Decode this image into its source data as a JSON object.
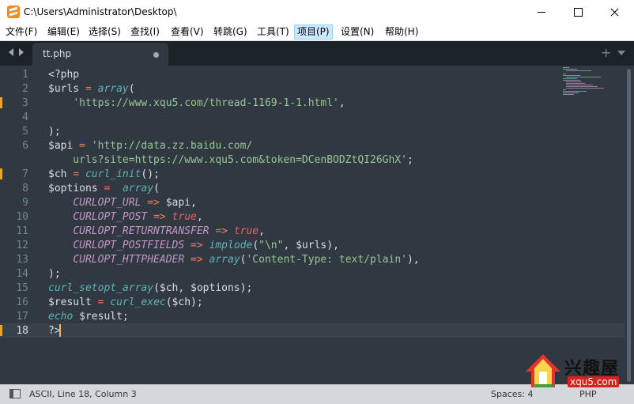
{
  "window": {
    "title": "C:\\Users\\Administrator\\Desktop\\"
  },
  "menu": [
    {
      "label": "文件(F)"
    },
    {
      "label": "编辑(E)"
    },
    {
      "label": "选择(S)"
    },
    {
      "label": "查找(I)"
    },
    {
      "label": "查看(V)"
    },
    {
      "label": "转跳(G)"
    },
    {
      "label": "工具(T)"
    },
    {
      "label": "项目(P)",
      "active": true
    },
    {
      "label": "设置(N)"
    },
    {
      "label": "帮助(H)"
    }
  ],
  "tabs": [
    {
      "label": "tt.php",
      "modified": true
    }
  ],
  "editor": {
    "line_numbers": [
      "1",
      "2",
      "3",
      "4",
      "5",
      "6",
      "",
      "7",
      "8",
      "9",
      "10",
      "11",
      "12",
      "13",
      "14",
      "15",
      "16",
      "17",
      "18"
    ],
    "current_line": "18",
    "lines": [
      [
        {
          "t": "<?php",
          "c": "plain"
        }
      ],
      [
        {
          "t": "$urls ",
          "c": "plain"
        },
        {
          "t": "=",
          "c": "op"
        },
        {
          "t": " ",
          "c": "plain"
        },
        {
          "t": "array",
          "c": "func"
        },
        {
          "t": "(",
          "c": "plain"
        }
      ],
      [
        {
          "t": "    ",
          "c": "plain"
        },
        {
          "t": "'https://www.xqu5.com/thread-1169-1-1.html'",
          "c": "str"
        },
        {
          "t": ",",
          "c": "plain"
        }
      ],
      [
        {
          "t": "",
          "c": "plain"
        }
      ],
      [
        {
          "t": ");",
          "c": "plain"
        }
      ],
      [
        {
          "t": "$api ",
          "c": "plain"
        },
        {
          "t": "=",
          "c": "op"
        },
        {
          "t": " ",
          "c": "plain"
        },
        {
          "t": "'http://data.zz.baidu.com/",
          "c": "str"
        }
      ],
      [
        {
          "t": "    urls?site=https://www.xqu5.com&token=DCenBODZtQI26GhX'",
          "c": "str"
        },
        {
          "t": ";",
          "c": "plain"
        }
      ],
      [
        {
          "t": "$ch ",
          "c": "plain"
        },
        {
          "t": "=",
          "c": "op"
        },
        {
          "t": " ",
          "c": "plain"
        },
        {
          "t": "curl_init",
          "c": "func"
        },
        {
          "t": "();",
          "c": "plain"
        }
      ],
      [
        {
          "t": "$options ",
          "c": "plain"
        },
        {
          "t": "=",
          "c": "op"
        },
        {
          "t": "  ",
          "c": "plain"
        },
        {
          "t": "array",
          "c": "func"
        },
        {
          "t": "(",
          "c": "plain"
        }
      ],
      [
        {
          "t": "    ",
          "c": "plain"
        },
        {
          "t": "CURLOPT_URL",
          "c": "const"
        },
        {
          "t": " ",
          "c": "plain"
        },
        {
          "t": "=>",
          "c": "op"
        },
        {
          "t": " $api,",
          "c": "plain"
        }
      ],
      [
        {
          "t": "    ",
          "c": "plain"
        },
        {
          "t": "CURLOPT_POST",
          "c": "const"
        },
        {
          "t": " ",
          "c": "plain"
        },
        {
          "t": "=>",
          "c": "op"
        },
        {
          "t": " ",
          "c": "plain"
        },
        {
          "t": "true",
          "c": "bool"
        },
        {
          "t": ",",
          "c": "plain"
        }
      ],
      [
        {
          "t": "    ",
          "c": "plain"
        },
        {
          "t": "CURLOPT_RETURNTRANSFER",
          "c": "const"
        },
        {
          "t": " ",
          "c": "plain"
        },
        {
          "t": "=>",
          "c": "op"
        },
        {
          "t": " ",
          "c": "plain"
        },
        {
          "t": "true",
          "c": "bool"
        },
        {
          "t": ",",
          "c": "plain"
        }
      ],
      [
        {
          "t": "    ",
          "c": "plain"
        },
        {
          "t": "CURLOPT_POSTFIELDS",
          "c": "const"
        },
        {
          "t": " ",
          "c": "plain"
        },
        {
          "t": "=>",
          "c": "op"
        },
        {
          "t": " ",
          "c": "plain"
        },
        {
          "t": "implode",
          "c": "func"
        },
        {
          "t": "(",
          "c": "plain"
        },
        {
          "t": "\"\\n\"",
          "c": "str"
        },
        {
          "t": ", $urls),",
          "c": "plain"
        }
      ],
      [
        {
          "t": "    ",
          "c": "plain"
        },
        {
          "t": "CURLOPT_HTTPHEADER",
          "c": "const"
        },
        {
          "t": " ",
          "c": "plain"
        },
        {
          "t": "=>",
          "c": "op"
        },
        {
          "t": " ",
          "c": "plain"
        },
        {
          "t": "array",
          "c": "func"
        },
        {
          "t": "(",
          "c": "plain"
        },
        {
          "t": "'Content-Type: text/plain'",
          "c": "str"
        },
        {
          "t": "),",
          "c": "plain"
        }
      ],
      [
        {
          "t": ");",
          "c": "plain"
        }
      ],
      [
        {
          "t": "curl_setopt_array",
          "c": "func"
        },
        {
          "t": "($ch, $options);",
          "c": "plain"
        }
      ],
      [
        {
          "t": "$result ",
          "c": "plain"
        },
        {
          "t": "=",
          "c": "op"
        },
        {
          "t": " ",
          "c": "plain"
        },
        {
          "t": "curl_exec",
          "c": "func"
        },
        {
          "t": "($ch);",
          "c": "plain"
        }
      ],
      [
        {
          "t": "echo",
          "c": "func"
        },
        {
          "t": " $result;",
          "c": "plain"
        }
      ],
      [
        {
          "t": "?>",
          "c": "plain"
        }
      ]
    ]
  },
  "status": {
    "left": "ASCII, Line 18, Column 3",
    "spaces": "Spaces: 4",
    "syntax": "PHP"
  },
  "watermark": {
    "name": "兴趣屋",
    "url": "xqu5.com"
  }
}
